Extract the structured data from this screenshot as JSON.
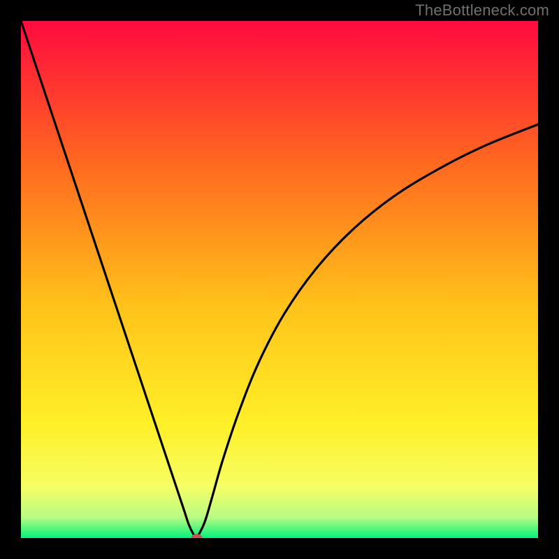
{
  "watermark": "TheBottleneck.com",
  "colors": {
    "top": "#ff0a3f",
    "mid1": "#ff6a1f",
    "mid2": "#ffc21a",
    "mid3": "#fff028",
    "mid4": "#f6fe64",
    "mid5": "#b8fc84",
    "bottom": "#00f27a",
    "curve": "#000000",
    "marker": "#c9544d"
  },
  "chart_data": {
    "type": "line",
    "title": "",
    "xlabel": "",
    "ylabel": "",
    "xlim": [
      0,
      100
    ],
    "ylim": [
      0,
      100
    ],
    "series": [
      {
        "name": "left-branch",
        "x": [
          0,
          5,
          10,
          15,
          20,
          25,
          28,
          30,
          31.5,
          32.5,
          33.5,
          34.0
        ],
        "values": [
          100,
          85.0,
          70.0,
          55.0,
          40.0,
          25.0,
          16.0,
          10.0,
          5.5,
          2.5,
          0.5,
          0.0
        ]
      },
      {
        "name": "right-branch",
        "x": [
          34.0,
          35.5,
          37.0,
          39.0,
          42.0,
          46.0,
          51.0,
          57.0,
          64.0,
          72.0,
          81.0,
          90.0,
          100.0
        ],
        "values": [
          0.0,
          3.0,
          8.0,
          15.0,
          24.0,
          34.0,
          43.5,
          52.0,
          59.5,
          66.0,
          71.5,
          76.0,
          80.0
        ]
      }
    ],
    "annotations": [
      {
        "name": "minimum-marker",
        "x": 34.0,
        "y": 0.0
      }
    ],
    "gradient_bands": [
      {
        "y_from": 100,
        "y_to": 78,
        "color": "#ff0a3f"
      },
      {
        "y_from": 78,
        "y_to": 55,
        "color": "#ff6a1f"
      },
      {
        "y_from": 55,
        "y_to": 35,
        "color": "#ffc21a"
      },
      {
        "y_from": 35,
        "y_to": 18,
        "color": "#fff028"
      },
      {
        "y_from": 18,
        "y_to": 8,
        "color": "#f6fe64"
      },
      {
        "y_from": 8,
        "y_to": 3,
        "color": "#b8fc84"
      },
      {
        "y_from": 3,
        "y_to": 0,
        "color": "#00f27a"
      }
    ]
  }
}
